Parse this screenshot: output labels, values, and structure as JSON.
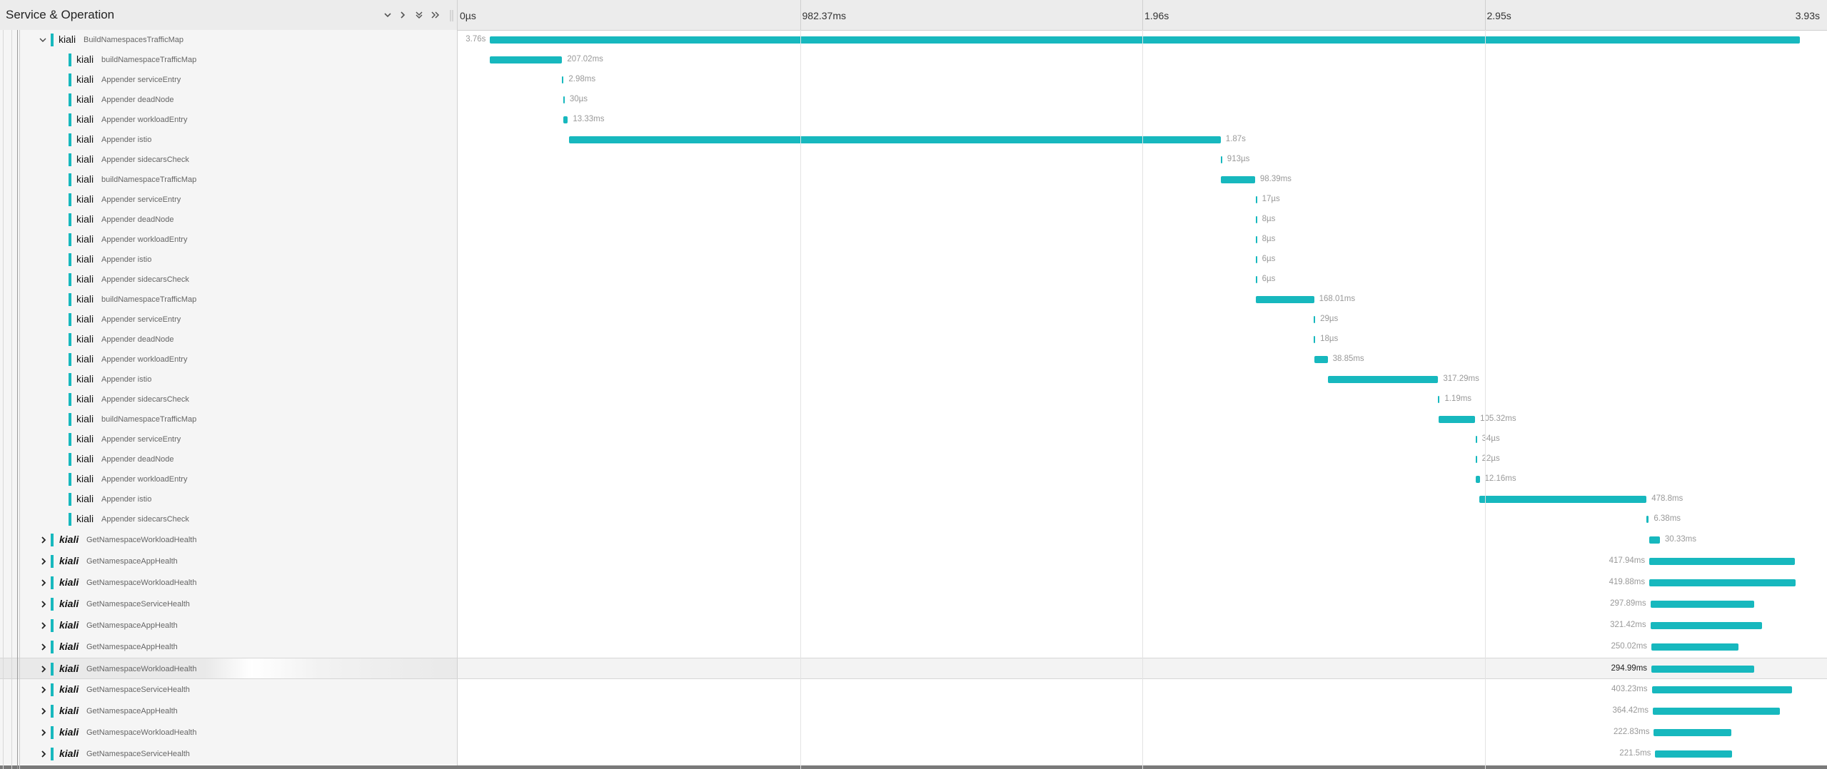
{
  "header": {
    "title": "Service & Operation",
    "ticks": [
      "0µs",
      "982.37ms",
      "1.96s",
      "2.95s",
      "3.93s"
    ]
  },
  "colors": {
    "bar": "#17b8be"
  },
  "icons": {
    "collapse_one": "chevron-down-icon",
    "expand_one": "chevron-right-icon",
    "collapse_all": "double-chevron-down-icon",
    "expand_all": "double-chevron-right-icon"
  },
  "spans": [
    {
      "service": "kiali",
      "operation": "BuildNamespacesTrafficMap",
      "duration": "3.76s",
      "start": 0.093,
      "width": 3.76,
      "level": 1,
      "toggle": "open"
    },
    {
      "service": "kiali",
      "operation": "buildNamespaceTrafficMap",
      "duration": "207.02ms",
      "start": 0.093,
      "width": 0.207,
      "level": 2
    },
    {
      "service": "kiali",
      "operation": "Appender serviceEntry",
      "duration": "2.98ms",
      "start": 0.3,
      "width": 0.003,
      "level": 2
    },
    {
      "service": "kiali",
      "operation": "Appender deadNode",
      "duration": "30µs",
      "start": 0.303,
      "width": 3e-05,
      "level": 2
    },
    {
      "service": "kiali",
      "operation": "Appender workloadEntry",
      "duration": "13.33ms",
      "start": 0.303,
      "width": 0.0133,
      "level": 2
    },
    {
      "service": "kiali",
      "operation": "Appender istio",
      "duration": "1.87s",
      "start": 0.32,
      "width": 1.87,
      "level": 2
    },
    {
      "service": "kiali",
      "operation": "Appender sidecarsCheck",
      "duration": "913µs",
      "start": 2.19,
      "width": 0.0009,
      "level": 2
    },
    {
      "service": "kiali",
      "operation": "buildNamespaceTrafficMap",
      "duration": "98.39ms",
      "start": 2.19,
      "width": 0.0984,
      "level": 2
    },
    {
      "service": "kiali",
      "operation": "Appender serviceEntry",
      "duration": "17µs",
      "start": 2.29,
      "width": 2e-05,
      "level": 2
    },
    {
      "service": "kiali",
      "operation": "Appender deadNode",
      "duration": "8µs",
      "start": 2.29,
      "width": 1e-05,
      "level": 2
    },
    {
      "service": "kiali",
      "operation": "Appender workloadEntry",
      "duration": "8µs",
      "start": 2.29,
      "width": 1e-05,
      "level": 2
    },
    {
      "service": "kiali",
      "operation": "Appender istio",
      "duration": "6µs",
      "start": 2.29,
      "width": 1e-05,
      "level": 2
    },
    {
      "service": "kiali",
      "operation": "Appender sidecarsCheck",
      "duration": "6µs",
      "start": 2.29,
      "width": 1e-05,
      "level": 2
    },
    {
      "service": "kiali",
      "operation": "buildNamespaceTrafficMap",
      "duration": "168.01ms",
      "start": 2.29,
      "width": 0.168,
      "level": 2
    },
    {
      "service": "kiali",
      "operation": "Appender serviceEntry",
      "duration": "29µs",
      "start": 2.457,
      "width": 3e-05,
      "level": 2
    },
    {
      "service": "kiali",
      "operation": "Appender deadNode",
      "duration": "18µs",
      "start": 2.457,
      "width": 2e-05,
      "level": 2
    },
    {
      "service": "kiali",
      "operation": "Appender workloadEntry",
      "duration": "38.85ms",
      "start": 2.458,
      "width": 0.0389,
      "level": 2
    },
    {
      "service": "kiali",
      "operation": "Appender istio",
      "duration": "317.29ms",
      "start": 2.497,
      "width": 0.317,
      "level": 2
    },
    {
      "service": "kiali",
      "operation": "Appender sidecarsCheck",
      "duration": "1.19ms",
      "start": 2.814,
      "width": 0.0012,
      "level": 2
    },
    {
      "service": "kiali",
      "operation": "buildNamespaceTrafficMap",
      "duration": "105.32ms",
      "start": 2.815,
      "width": 0.105,
      "level": 2
    },
    {
      "service": "kiali",
      "operation": "Appender serviceEntry",
      "duration": "34µs",
      "start": 2.921,
      "width": 3e-05,
      "level": 2
    },
    {
      "service": "kiali",
      "operation": "Appender deadNode",
      "duration": "22µs",
      "start": 2.921,
      "width": 2e-05,
      "level": 2
    },
    {
      "service": "kiali",
      "operation": "Appender workloadEntry",
      "duration": "12.16ms",
      "start": 2.921,
      "width": 0.0122,
      "level": 2
    },
    {
      "service": "kiali",
      "operation": "Appender istio",
      "duration": "478.8ms",
      "start": 2.933,
      "width": 0.479,
      "level": 2
    },
    {
      "service": "kiali",
      "operation": "Appender sidecarsCheck",
      "duration": "6.38ms",
      "start": 3.412,
      "width": 0.0064,
      "level": 2
    },
    {
      "service": "kiali",
      "operation": "GetNamespaceWorkloadHealth",
      "duration": "30.33ms",
      "start": 3.42,
      "width": 0.0303,
      "level": 0,
      "toggle": "closed"
    },
    {
      "service": "kiali",
      "operation": "GetNamespaceAppHealth",
      "duration": "417.94ms",
      "start": 3.42,
      "width": 0.418,
      "level": 0,
      "toggle": "closed"
    },
    {
      "service": "kiali",
      "operation": "GetNamespaceWorkloadHealth",
      "duration": "419.88ms",
      "start": 3.42,
      "width": 0.42,
      "level": 0,
      "toggle": "closed"
    },
    {
      "service": "kiali",
      "operation": "GetNamespaceServiceHealth",
      "duration": "297.89ms",
      "start": 3.423,
      "width": 0.298,
      "level": 0,
      "toggle": "closed"
    },
    {
      "service": "kiali",
      "operation": "GetNamespaceAppHealth",
      "duration": "321.42ms",
      "start": 3.423,
      "width": 0.321,
      "level": 0,
      "toggle": "closed"
    },
    {
      "service": "kiali",
      "operation": "GetNamespaceAppHealth",
      "duration": "250.02ms",
      "start": 3.426,
      "width": 0.25,
      "level": 0,
      "toggle": "closed"
    },
    {
      "service": "kiali",
      "operation": "GetNamespaceWorkloadHealth",
      "duration": "294.99ms",
      "start": 3.426,
      "width": 0.295,
      "level": 0,
      "toggle": "closed",
      "selected": true
    },
    {
      "service": "kiali",
      "operation": "GetNamespaceServiceHealth",
      "duration": "403.23ms",
      "start": 3.427,
      "width": 0.403,
      "level": 0,
      "toggle": "closed"
    },
    {
      "service": "kiali",
      "operation": "GetNamespaceAppHealth",
      "duration": "364.42ms",
      "start": 3.43,
      "width": 0.364,
      "level": 0,
      "toggle": "closed"
    },
    {
      "service": "kiali",
      "operation": "GetNamespaceWorkloadHealth",
      "duration": "222.83ms",
      "start": 3.433,
      "width": 0.223,
      "level": 0,
      "toggle": "closed"
    },
    {
      "service": "kiali",
      "operation": "GetNamespaceServiceHealth",
      "duration": "221.5ms",
      "start": 3.437,
      "width": 0.2215,
      "level": 0,
      "toggle": "closed"
    }
  ]
}
